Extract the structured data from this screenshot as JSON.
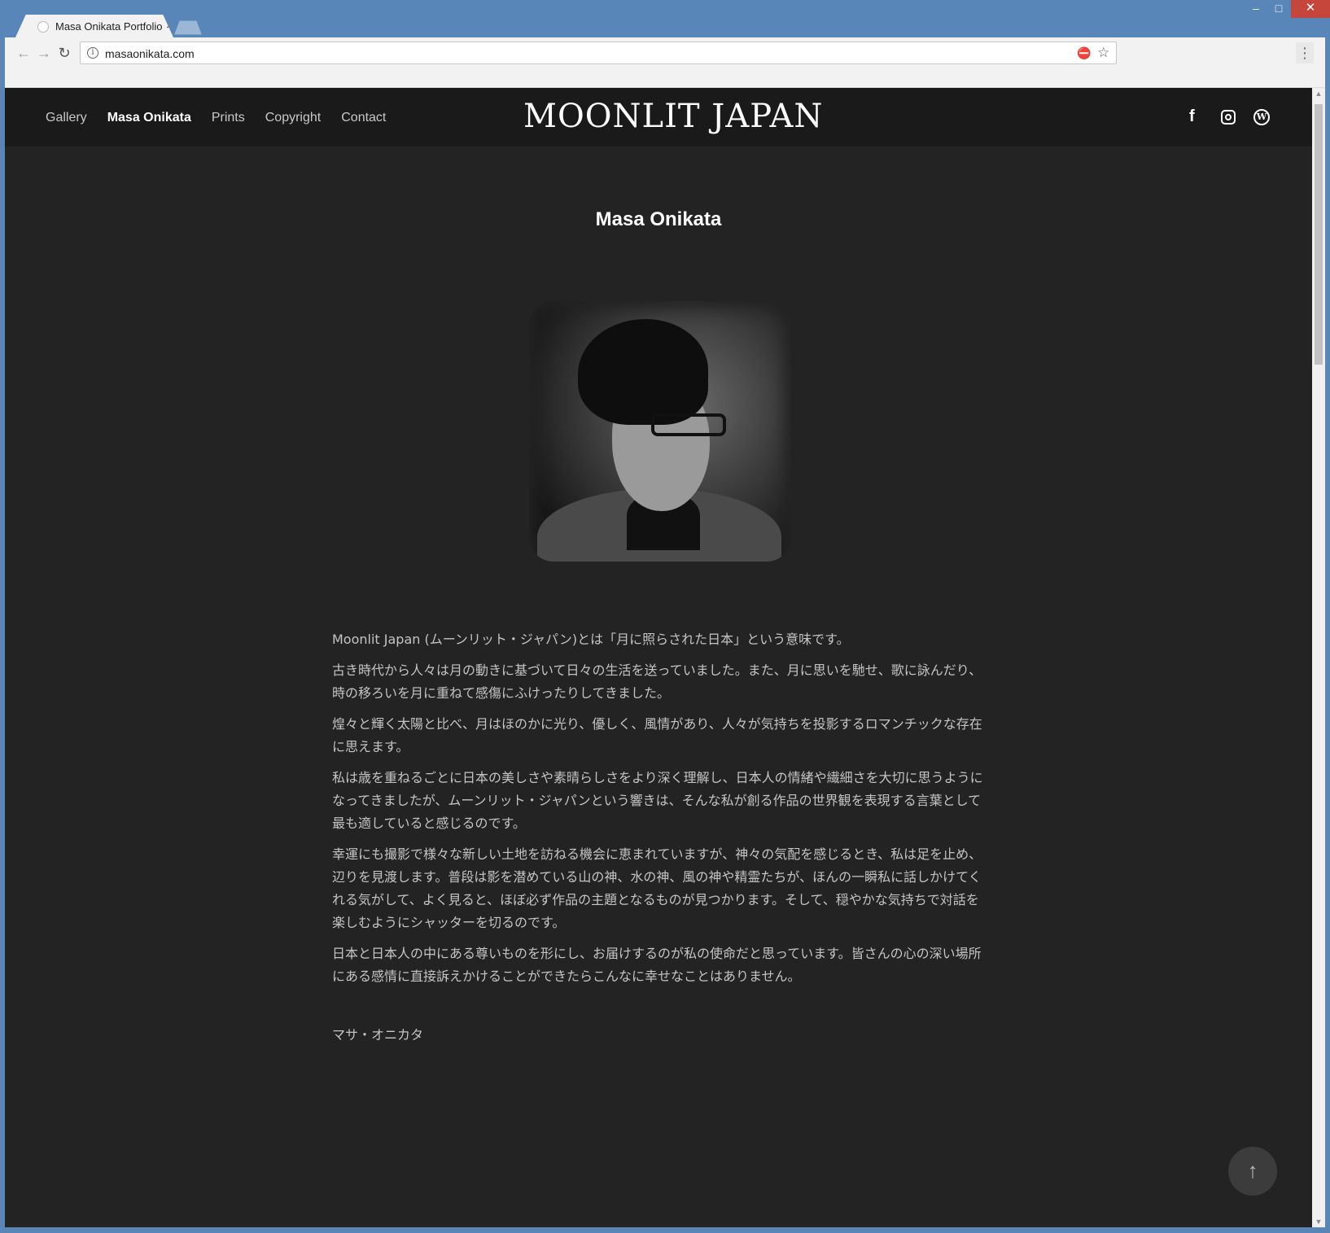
{
  "window": {
    "minimize": "–",
    "maximize": "□",
    "close": "✕"
  },
  "tab": {
    "title": "Masa Onikata Portfolio",
    "close": "×"
  },
  "toolbar": {
    "back": "←",
    "forward": "→",
    "reload": "↻",
    "info": "i",
    "url": "masaonikata.com",
    "star": "☆",
    "menu": "⋮"
  },
  "site": {
    "nav": [
      "Gallery",
      "Masa Onikata",
      "Prints",
      "Copyright",
      "Contact"
    ],
    "active_nav": "Masa Onikata",
    "logo": "MOONLIT JAPAN",
    "social_icons": [
      "facebook-icon",
      "instagram-icon",
      "wordpress-icon"
    ]
  },
  "main": {
    "title": "Masa Onikata",
    "paragraphs": [
      "Moonlit Japan (ムーンリット・ジャパン)とは「月に照らされた日本」という意味です。",
      "古き時代から人々は月の動きに基づいて日々の生活を送っていました。また、月に思いを馳せ、歌に詠んだり、時の移ろいを月に重ねて感傷にふけったりしてきました。",
      "煌々と輝く太陽と比べ、月はほのかに光り、優しく、風情があり、人々が気持ちを投影するロマンチックな存在に思えます。",
      "私は歳を重ねるごとに日本の美しさや素晴らしさをより深く理解し、日本人の情緒や繊細さを大切に思うようになってきましたが、ムーンリット・ジャパンという響きは、そんな私が創る作品の世界観を表現する言葉として最も適していると感じるのです。",
      "幸運にも撮影で様々な新しい土地を訪ねる機会に恵まれていますが、神々の気配を感じるとき、私は足を止め、辺りを見渡します。普段は影を潜めている山の神、水の神、風の神や精霊たちが、ほんの一瞬私に話しかけてくれる気がして、よく見ると、ほぼ必ず作品の主題となるものが見つかります。そして、穏やかな気持ちで対話を楽しむようにシャッターを切るのです。",
      "日本と日本人の中にある尊いものを形にし、お届けするのが私の使命だと思っています。皆さんの心の深い場所にある感情に直接訴えかけることができたらこんなに幸せなことはありません。"
    ],
    "signature": "マサ・オニカタ"
  },
  "back_to_top": "↑"
}
